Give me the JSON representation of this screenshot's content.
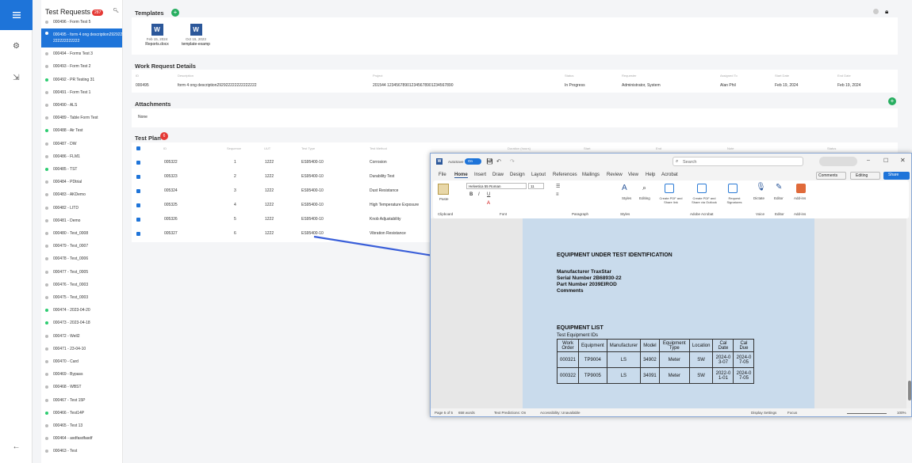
{
  "rail": {
    "menu_icon": "hamburger-icon",
    "settings_icon": "gear-icon",
    "logout_icon": "sign-out-icon",
    "collapse_icon": "arrow-left-icon"
  },
  "list": {
    "title": "Test Requests",
    "count": "287",
    "items": [
      {
        "label": "000496 - Form Test 5",
        "status": "grey"
      },
      {
        "label": "000495 - form 4 ong description292922222222222222",
        "status": "grey",
        "selected": true
      },
      {
        "label": "000494 - Forms Test 3",
        "status": "grey"
      },
      {
        "label": "000493 - Form Test 2",
        "status": "grey"
      },
      {
        "label": "000492 - PR Testing 31",
        "status": "green"
      },
      {
        "label": "000491 - Form Test 1",
        "status": "grey"
      },
      {
        "label": "000490 - ALS",
        "status": "grey"
      },
      {
        "label": "000489 - Table Form Test",
        "status": "grey"
      },
      {
        "label": "000488 - Air Test",
        "status": "green"
      },
      {
        "label": "000487 - DW",
        "status": "grey"
      },
      {
        "label": "000486 - FLM1",
        "status": "grey"
      },
      {
        "label": "000485 - TST",
        "status": "green"
      },
      {
        "label": "000484 - PDtrial",
        "status": "grey"
      },
      {
        "label": "000483 - AKDemo",
        "status": "grey"
      },
      {
        "label": "000482 - LITD",
        "status": "grey"
      },
      {
        "label": "000481 - Demo",
        "status": "grey"
      },
      {
        "label": "000480 - Test_0008",
        "status": "grey"
      },
      {
        "label": "000479 - Test_0007",
        "status": "grey"
      },
      {
        "label": "000478 - Test_0006",
        "status": "grey"
      },
      {
        "label": "000477 - Test_0005",
        "status": "grey"
      },
      {
        "label": "000476 - Test_0003",
        "status": "grey"
      },
      {
        "label": "000475 - Test_0003",
        "status": "grey"
      },
      {
        "label": "000474 - 2023-04-20",
        "status": "green"
      },
      {
        "label": "000473 - 2023-04-18",
        "status": "green"
      },
      {
        "label": "000472 - Well2",
        "status": "grey"
      },
      {
        "label": "000471 - 23-04-10",
        "status": "grey"
      },
      {
        "label": "000470 - Card",
        "status": "grey"
      },
      {
        "label": "000469 - Bypass",
        "status": "grey"
      },
      {
        "label": "000468 - WBST",
        "status": "grey"
      },
      {
        "label": "000467 - Test 15P",
        "status": "grey"
      },
      {
        "label": "000466 - Test14P",
        "status": "green"
      },
      {
        "label": "000465 - Test 13",
        "status": "grey"
      },
      {
        "label": "000464 - asdfasdfasdf",
        "status": "grey"
      },
      {
        "label": "000463 - Test",
        "status": "grey"
      }
    ]
  },
  "templates": {
    "title": "Templates",
    "items": [
      {
        "date": "Feb 15, 2024",
        "name": "Reports.docx"
      },
      {
        "date": "Oct 15, 2023",
        "name": "template-examp"
      }
    ]
  },
  "work_request": {
    "title": "Work Request Details",
    "headers": [
      "ID",
      "Description",
      "Project",
      "Status",
      "Requester",
      "Assigned To",
      "Start Date",
      "End Date"
    ],
    "values": [
      "000495",
      "form 4 ong description292922222222222222",
      "201544 1234567890123456789012345​67890",
      "In Progress",
      "Administrator, System",
      "Alan Phil",
      "Feb 19, 2024",
      "Feb 19, 2024"
    ]
  },
  "attachments": {
    "title": "Attachments",
    "value": "None"
  },
  "test_plan": {
    "title": "Test Plan",
    "count": "6",
    "headers": [
      "ID",
      "Sequence",
      "UUT",
      "Test Type",
      "Test Method",
      "Duration (hours)",
      "Start",
      "End",
      "Note",
      "Status"
    ],
    "rows": [
      {
        "id": "005322",
        "seq": "1",
        "uut": "1222",
        "type": "ES95400-10",
        "method": "Corrosion"
      },
      {
        "id": "005323",
        "seq": "2",
        "uut": "1222",
        "type": "ES95400-10",
        "method": "Durability Test"
      },
      {
        "id": "005324",
        "seq": "3",
        "uut": "1222",
        "type": "ES95400-10",
        "method": "Dust Resistance"
      },
      {
        "id": "005325",
        "seq": "4",
        "uut": "1222",
        "type": "ES95400-10",
        "method": "High Temperature Exposure"
      },
      {
        "id": "005326",
        "seq": "5",
        "uut": "1222",
        "type": "ES95400-10",
        "method": "Knob Adjustability"
      },
      {
        "id": "005327",
        "seq": "6",
        "uut": "1222",
        "type": "ES95400-10",
        "method": "Vibration Resistance"
      }
    ]
  },
  "word": {
    "autosave": "AutoSave",
    "autosave_state": "On",
    "search": "Search",
    "menu": [
      "File",
      "Home",
      "Insert",
      "Draw",
      "Design",
      "Layout",
      "References",
      "Mailings",
      "Review",
      "View",
      "Help",
      "Acrobat"
    ],
    "comments": "Comments",
    "editing": "Editing",
    "share": "Share",
    "font": "Helvetica 55 Roman",
    "size": "11",
    "groups": [
      "Clipboard",
      "Font",
      "Paragraph",
      "Styles",
      "Adobe Acrobat",
      "Voice",
      "Editor",
      "Add-ins"
    ],
    "buttons": [
      "Paste",
      "Styles",
      "Editing",
      "Create PDF and Share link",
      "Create PDF and Share via Outlook",
      "Request Signatures",
      "Dictate",
      "Editor",
      "Add-ins"
    ],
    "status": {
      "page": "Page 5 of 5",
      "words": "658 words",
      "predictions": "Text Predictions: On",
      "accessibility": "Accessibility: Unavailable",
      "display": "Display Settings",
      "focus": "Focus",
      "zoom": "100%"
    },
    "doc": {
      "h1": "EQUIPMENT UNDER TEST IDENTIFICATION",
      "manufacturer": "Manufacturer TraxStar",
      "serial": "Serial Number 2B68930-22",
      "part": "Part Number 2039EIROD",
      "comments": "Comments",
      "h2": "EQUIPMENT LIST",
      "caption": "Test Equipment IDs",
      "table_headers": [
        "Work Order",
        "Equipment",
        "Manufacturer",
        "Model",
        "Equipment Type",
        "Location",
        "Cal Date",
        "Cal Due"
      ],
      "table_rows": [
        [
          "000321",
          "TP9004",
          "LS",
          "34902",
          "Meter",
          "SW",
          "2024-03-07",
          "2024-07-05"
        ],
        [
          "000322",
          "TP9005",
          "LS",
          "34091",
          "Meter",
          "SW",
          "2022-01-01",
          "2024-07-05"
        ]
      ]
    }
  },
  "colors": {
    "accent": "#1e74d9",
    "add": "#27ae60",
    "badge": "#e53935",
    "arrow": "#3a5fd9"
  }
}
